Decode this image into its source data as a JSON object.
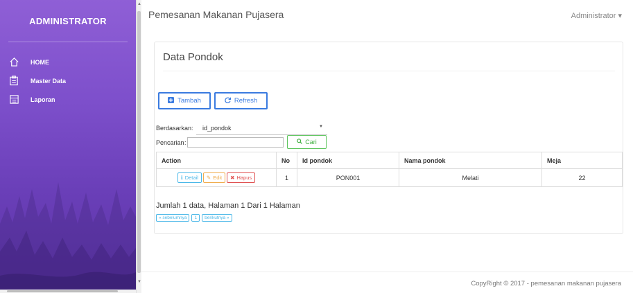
{
  "sidebar": {
    "brand": "ADMINISTRATOR",
    "items": [
      {
        "label": "HOME",
        "icon": "home-icon"
      },
      {
        "label": "Master Data",
        "icon": "clipboard-icon"
      },
      {
        "label": "Laporan",
        "icon": "report-icon"
      }
    ]
  },
  "topbar": {
    "title": "Pemesanan Makanan Pujasera",
    "user": "Administrator ▾"
  },
  "main": {
    "title": "Data Pondok",
    "buttons": {
      "tambah": "Tambah",
      "refresh": "Refresh"
    },
    "filter": {
      "berdasarkan_label": "Berdasarkan:",
      "selected": "id_pondok",
      "pencarian_label": "Pencarian",
      "colon": ":",
      "search_value": "",
      "cari": "Cari"
    },
    "table": {
      "headers": [
        "Action",
        "No",
        "Id pondok",
        "Nama pondok",
        "Meja"
      ],
      "rows": [
        {
          "no": "1",
          "id": "PON001",
          "nama": "Melati",
          "meja": "22"
        }
      ],
      "actions": {
        "detail": "Detail",
        "edit": "Edit",
        "hapus": "Hapus"
      }
    },
    "summary": "Jumlah 1 data, Halaman 1 Dari 1 Halaman",
    "pager": {
      "prev": "« sebelumnya",
      "page": "1",
      "next": "berikutnya »"
    }
  },
  "footer": "CopyRight © 2017 - pemesanan makanan pujasera",
  "colors": {
    "sidebar_top": "#8f5fd6",
    "sidebar_bottom": "#5b33a6",
    "primary": "#3a7be0",
    "success": "#3faf3f",
    "info": "#4bb8e8",
    "warning": "#f0ad4e",
    "danger": "#e05252"
  }
}
